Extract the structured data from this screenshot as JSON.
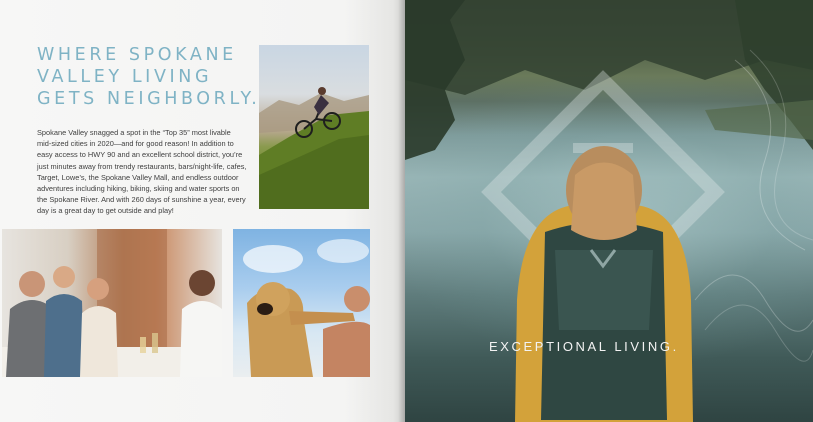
{
  "left_page": {
    "headline": [
      "WHERE SPOKANE",
      "VALLEY LIVING",
      "GETS NEIGHBORLY."
    ],
    "body": "Spokane Valley snagged a spot in the “Top 35” most livable mid-sized cities in 2020—and for good reason! In addition to easy access to HWY 90 and an excellent school district, you’re just minutes away from trendy restaurants, bars/night-life, cafes, Target, Lowe’s, the Spokane Valley Mall, and endless outdoor adventures including hiking, biking, skiing and water sports on the Spokane River. And with 260 days of sunshine a year, every day is a great day to get outside and play!"
  },
  "right_page": {
    "tagline": "EXCEPTIONAL LIVING."
  },
  "colors": {
    "headline": "#7fb3c5",
    "body_text": "#3f3f3f",
    "tagline": "#f3f3f3"
  }
}
